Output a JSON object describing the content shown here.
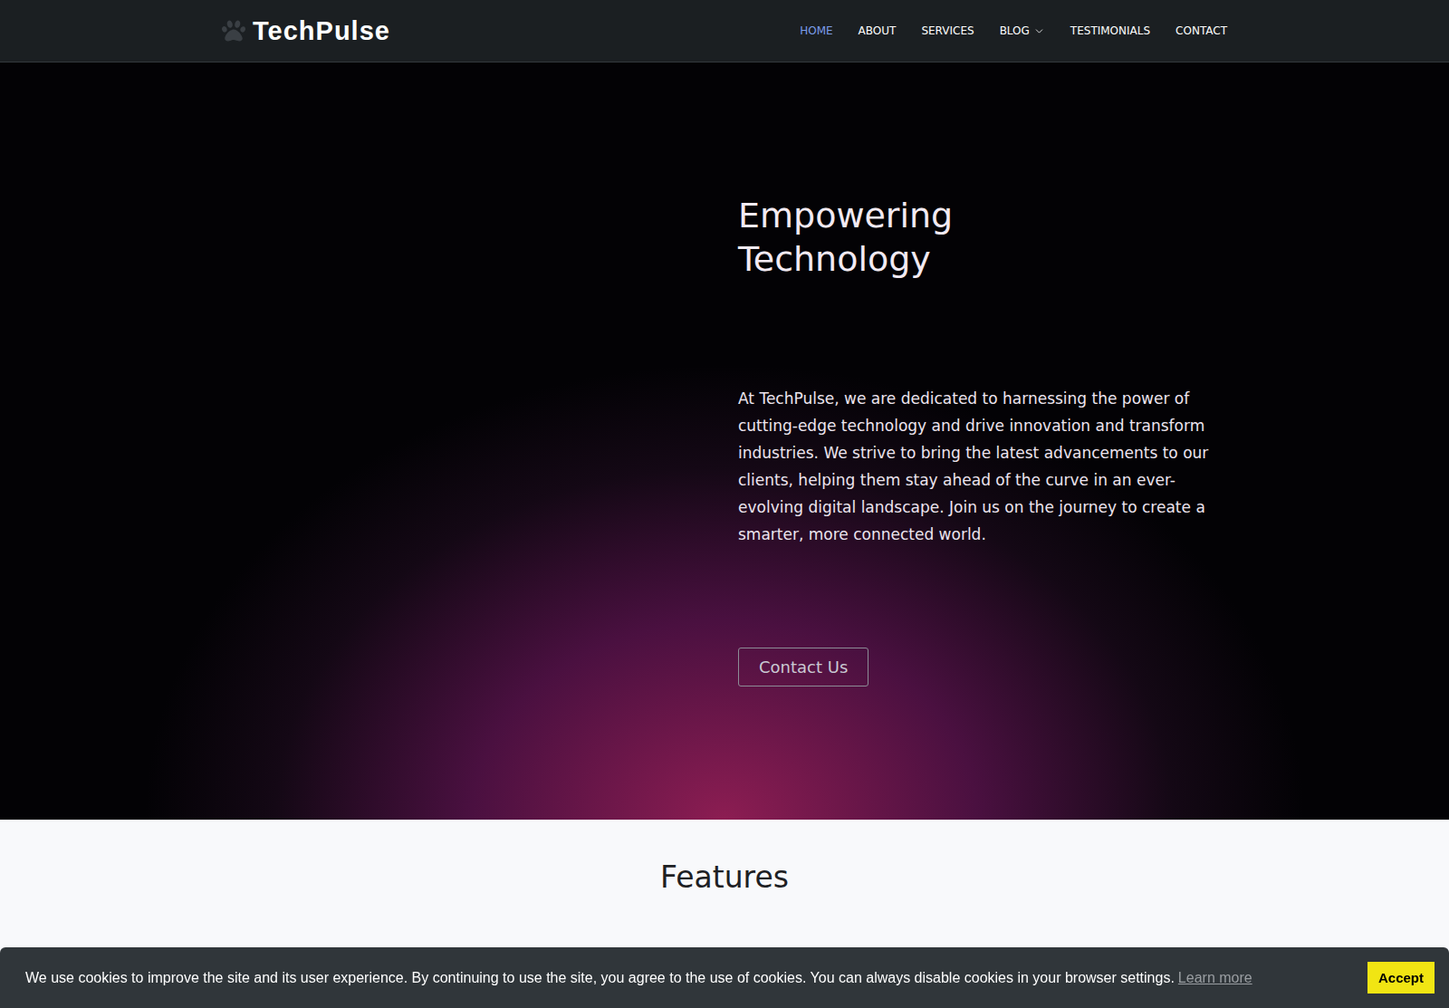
{
  "navbar": {
    "logo": "TechPulse",
    "items": [
      {
        "label": "HOME",
        "selected": true,
        "dropdown": false
      },
      {
        "label": "ABOUT",
        "selected": false,
        "dropdown": false
      },
      {
        "label": "SERVICES",
        "selected": false,
        "dropdown": false
      },
      {
        "label": "BLOG",
        "selected": false,
        "dropdown": true
      },
      {
        "label": "TESTIMONIALS",
        "selected": false,
        "dropdown": false
      },
      {
        "label": "CONTACT",
        "selected": false,
        "dropdown": false
      }
    ]
  },
  "hero": {
    "title": "Empowering Technology",
    "text": "At TechPulse, we are dedicated to harnessing the power of cutting-edge technology and drive innovation and transform industries. We strive to bring the latest advancements to our clients, helping them stay ahead of the curve in an ever-evolving digital landscape. Join us on the journey to create a smarter, more connected world.",
    "button": "Contact Us"
  },
  "features": {
    "title": "Features"
  },
  "cookie_banner": {
    "text": "We use cookies to improve the site and its user experience. By continuing to use the site, you agree to the use of cookies. You can always disable cookies in your browser settings.",
    "link": "Learn more",
    "button": "Accept"
  }
}
